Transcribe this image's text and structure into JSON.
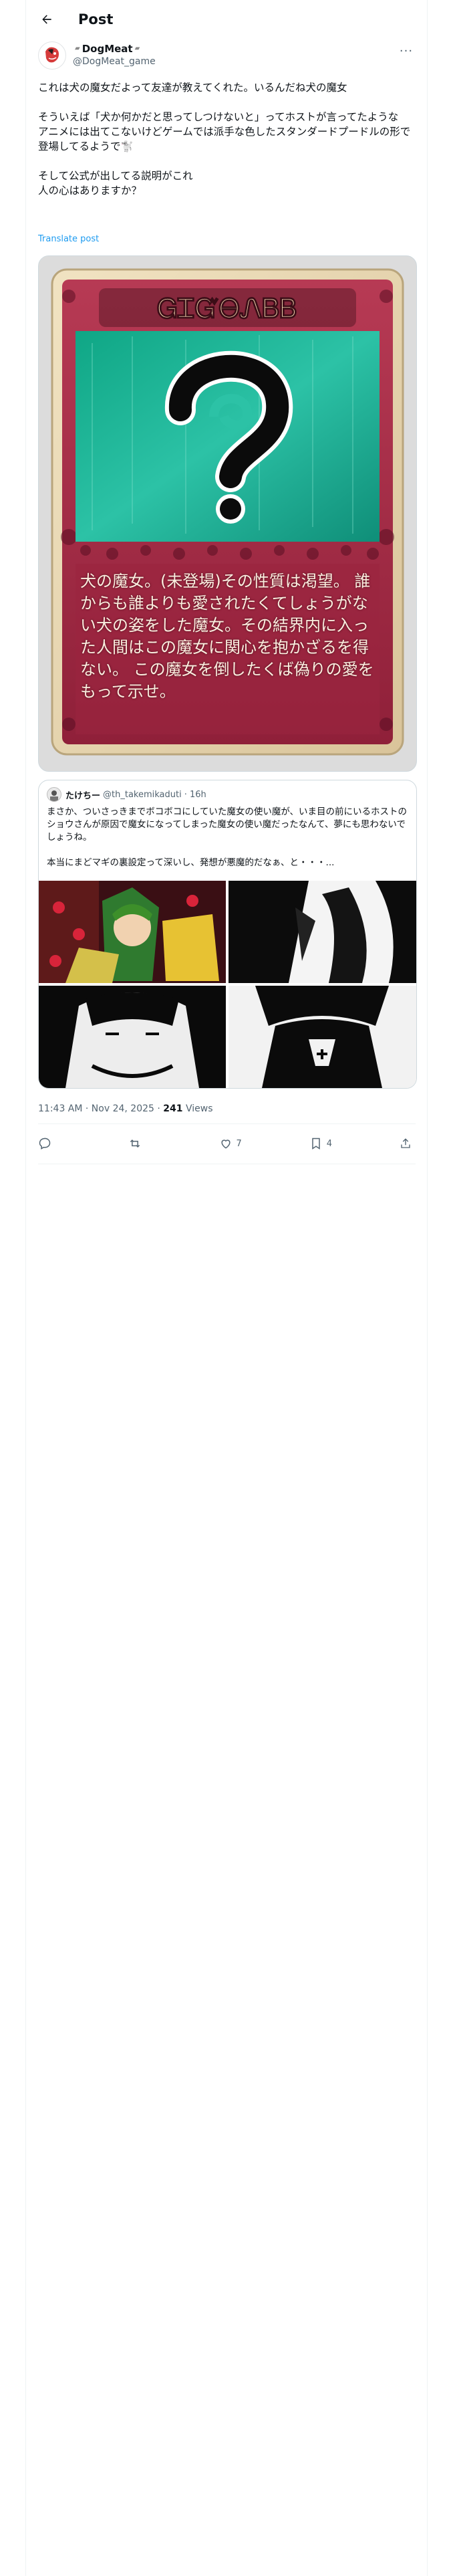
{
  "header": {
    "title": "Post"
  },
  "author": {
    "display_name": "DogMeat",
    "handle": "@DogMeat_game"
  },
  "post": {
    "text": "これは犬の魔女だよって友達が教えてくれた。いるんだね犬の魔女\n\nそういえば「犬か何かだと思ってしつけないと」ってホストが言ってたような\nアニメには出てこないけどゲームでは派手な色したスタンダードプードルの形で登場してるようで🐩\n\nそして公式が出してる説明がこれ\n人の心はありますか？",
    "translate_label": "Translate post"
  },
  "card_image": {
    "banner_text": "ᏀᏆᏳᎾᏁᏴᏴ",
    "description": "犬の魔女。(未登場)その性質は渇望。 誰からも誰よりも愛されたくてしょうがない犬の姿をした魔女。その結界内に入った人間はこの魔女に関心を抱かざるを得ない。 この魔女を倒したくば偽りの愛をもって示せ。"
  },
  "quote": {
    "name": "たけちー",
    "handle": "@th_takemikaduti",
    "time": "· 16h",
    "text": "まさか、ついさっきまでボコボコにしていた魔女の使い魔が、いま目の前にいるホストのショウさんが原因で魔女になってしまった魔女の使い魔だったなんて、夢にも思わないでしょうね。\n\n本当にまどマギの裏設定って深いし、発想が悪魔的だなぁ、と・・・..."
  },
  "meta": {
    "time": "11:43 AM · Nov 24, 2025 · ",
    "views_count": "241",
    "views_label": " Views"
  },
  "actions": {
    "reply": "",
    "repost": "",
    "like": "7",
    "bookmark": "4"
  },
  "colors": {
    "card_frame": "#a8324b",
    "card_teal": "#1aa488",
    "link": "#1d9bf0"
  }
}
